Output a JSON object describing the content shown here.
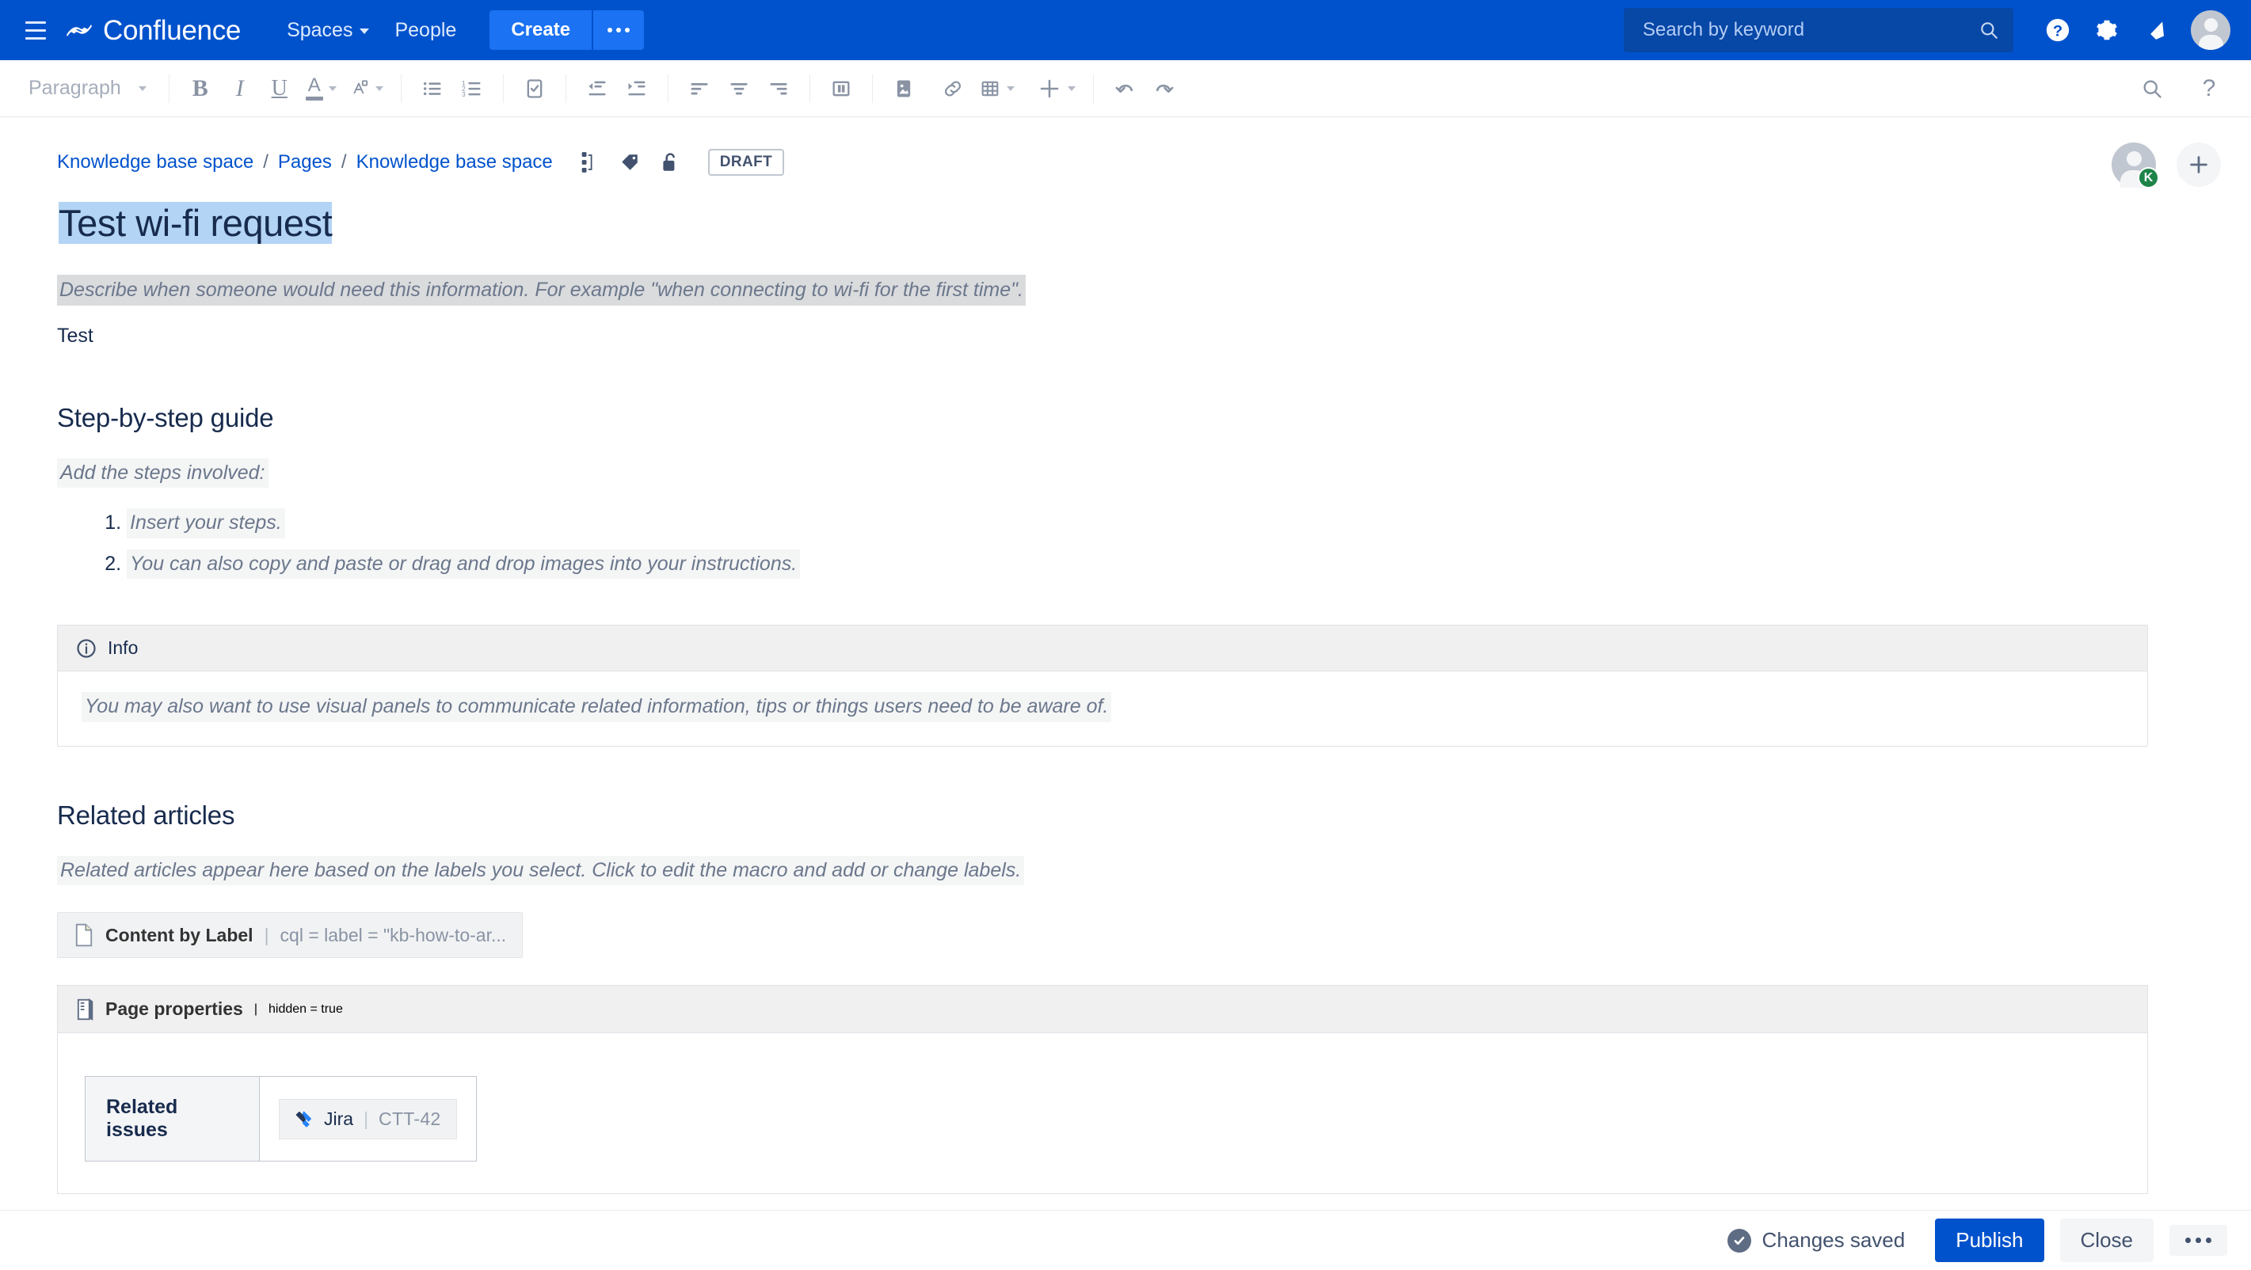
{
  "nav": {
    "menu_icon": "hamburger-icon",
    "brand": "Confluence",
    "spaces_label": "Spaces",
    "people_label": "People",
    "create_label": "Create",
    "create_more_icon": "ellipsis-icon",
    "search": {
      "placeholder": "Search by keyword",
      "value": "",
      "icon": "search-icon"
    },
    "help_icon": "help-icon",
    "settings_icon": "gear-icon",
    "notifications_icon": "notification-bell-icon",
    "profile_icon": "avatar-icon",
    "bg_color": "#0052CC",
    "create_color": "#1B72F2"
  },
  "toolbar": {
    "style_label": "Paragraph",
    "buttons": [
      {
        "name": "bold-button",
        "label": "B"
      },
      {
        "name": "italic-button",
        "label": "I"
      },
      {
        "name": "underline-button",
        "label": "U"
      },
      {
        "name": "text-color-button",
        "label": "A"
      },
      {
        "name": "text-highlight-button",
        "label": "A"
      },
      {
        "name": "bullet-list-button",
        "label": ""
      },
      {
        "name": "numbered-list-button",
        "label": ""
      },
      {
        "name": "task-list-button",
        "label": ""
      },
      {
        "name": "outdent-button",
        "label": ""
      },
      {
        "name": "indent-button",
        "label": ""
      },
      {
        "name": "align-left-button",
        "label": ""
      },
      {
        "name": "align-center-button",
        "label": ""
      },
      {
        "name": "align-right-button",
        "label": ""
      },
      {
        "name": "page-layout-button",
        "label": ""
      },
      {
        "name": "insert-image-button",
        "label": ""
      },
      {
        "name": "insert-link-button",
        "label": ""
      },
      {
        "name": "insert-table-button",
        "label": ""
      },
      {
        "name": "insert-more-button",
        "label": ""
      },
      {
        "name": "undo-button",
        "label": ""
      },
      {
        "name": "redo-button",
        "label": ""
      }
    ],
    "find_icon": "search-icon",
    "help_label": "?"
  },
  "breadcrumb": {
    "items": [
      "Knowledge base space",
      "Pages",
      "Knowledge base space"
    ],
    "separator": "/",
    "icons": [
      "page-tree-icon",
      "label-tag-icon",
      "unlock-restrictions-icon"
    ],
    "status_badge": "DRAFT"
  },
  "page_widgets": {
    "avatar_initial": "K",
    "avatar_badge_color": "#1E8449",
    "add_icon": "plus-icon"
  },
  "document": {
    "title": "Test wi-fi request",
    "title_selected": true,
    "intro_instruction": "Describe when someone would need this information. For example \"when connecting to wi-fi for the first time\".",
    "intro_body": "Test",
    "section_steps_heading": "Step-by-step guide",
    "steps_instruction": "Add the steps involved:",
    "steps": [
      "Insert your steps.",
      "You can also copy and paste or drag and drop images into your instructions."
    ],
    "info_panel": {
      "icon": "info-icon",
      "title": "Info",
      "body": "You may also want to use visual panels to communicate related information, tips or things users need to be aware of."
    },
    "section_related_heading": "Related articles",
    "related_instruction": "Related articles appear here based on the labels you select. Click to edit the macro and add or change labels.",
    "content_by_label_macro": {
      "icon": "page-macro-icon",
      "name": "Content by Label",
      "divider": "|",
      "params": "cql = label = \"kb-how-to-ar..."
    },
    "page_properties_macro": {
      "icon": "page-properties-icon",
      "name": "Page properties",
      "divider": "|",
      "params": "hidden = true",
      "table": {
        "rows": [
          {
            "header": "Related issues",
            "value_chip": {
              "icon": "jira-icon",
              "name": "Jira",
              "divider": "|",
              "key": "CTT-42"
            }
          }
        ]
      }
    }
  },
  "footer": {
    "status_icon": "check-circle-icon",
    "status_text": "Changes saved",
    "publish_label": "Publish",
    "close_label": "Close",
    "more_icon": "ellipsis-icon",
    "publish_color": "#0052CC"
  }
}
